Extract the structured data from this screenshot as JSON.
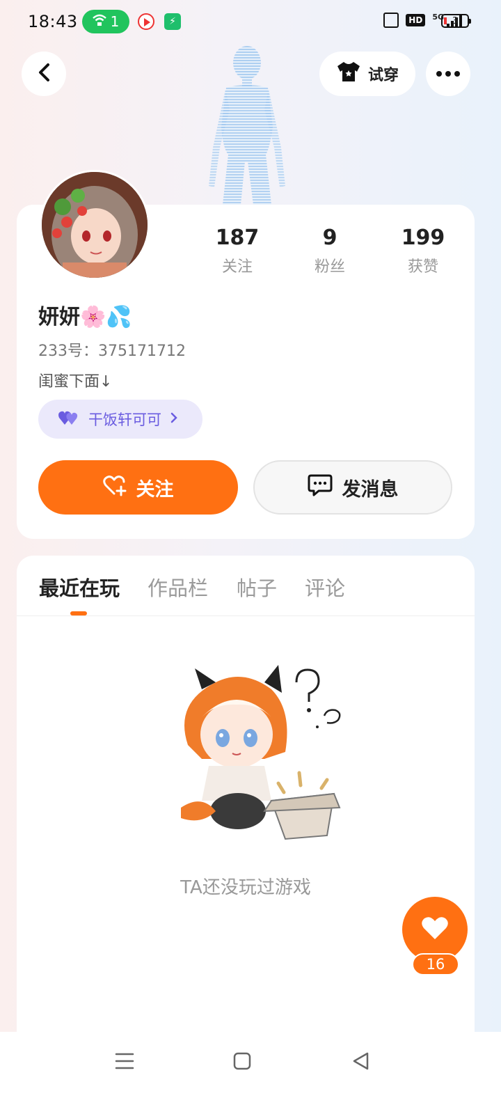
{
  "status_bar": {
    "time": "18:43",
    "wifi_count": "1",
    "network": "5G",
    "hd": "HD",
    "battery": "3"
  },
  "header": {
    "tryon_label": "试穿"
  },
  "profile": {
    "stats": [
      {
        "value": "187",
        "label": "关注"
      },
      {
        "value": "9",
        "label": "粉丝"
      },
      {
        "value": "199",
        "label": "获赞"
      }
    ],
    "nickname": "妍妍🌸💦",
    "uid": "233号：375171712",
    "bio": "闺蜜下面↓",
    "tag": "干饭轩可可",
    "follow_label": "关注",
    "message_label": "发消息"
  },
  "tabs": [
    {
      "label": "最近在玩",
      "active": true
    },
    {
      "label": "作品栏",
      "active": false
    },
    {
      "label": "帖子",
      "active": false
    },
    {
      "label": "评论",
      "active": false
    }
  ],
  "empty_state": "TA还没玩过游戏",
  "like": {
    "count": "16"
  },
  "colors": {
    "accent": "#ff7012",
    "tag_purple": "#6a5ce0"
  }
}
